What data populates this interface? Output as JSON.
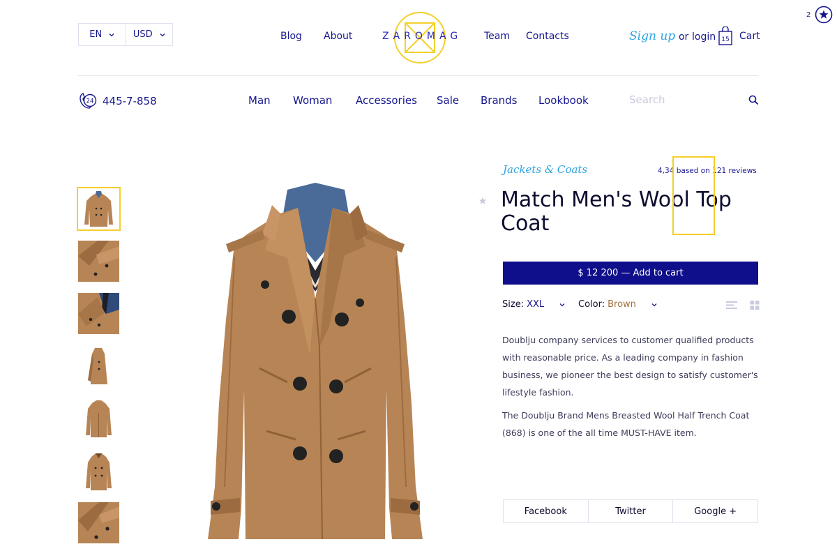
{
  "colors": {
    "primary": "#0f0f8c",
    "accent_blue": "#2ba3e0",
    "logo_yellow": "#f5cf2b",
    "coat_brown": "#b78455",
    "color_value": "#a0703a"
  },
  "header": {
    "language": "EN",
    "currency": "USD",
    "nav_left": [
      "Blog",
      "About"
    ],
    "logo": "ZAROMAG",
    "nav_right": [
      "Team",
      "Contacts"
    ],
    "sign_up": "Sign up",
    "or": "or",
    "login": "login",
    "cart_count": "15",
    "cart_label": "Cart",
    "corner_count": "2"
  },
  "subheader": {
    "phone_badge": "24",
    "phone": "445-7-858",
    "categories": [
      "Man",
      "Woman",
      "Accessories",
      "Sale",
      "Brands",
      "Lookbook"
    ],
    "search_placeholder": "Search"
  },
  "gallery": {
    "thumbnails": [
      "front",
      "lapel-detail",
      "collar-detail",
      "side",
      "back",
      "front-alt",
      "button-detail"
    ],
    "active_index": 0,
    "icons": [
      "coat-image"
    ]
  },
  "product": {
    "category": "Jackets & Coats",
    "rating": "4,34",
    "rating_text": "based on 121 reviews",
    "title": "Match Men's Wool Top Coat",
    "buy_label": "$ 12 200 — Add to cart",
    "size_label": "Size:",
    "size_value": "XXL",
    "color_label": "Color:",
    "color_value": "Brown",
    "description": [
      "Doublju company services to customer qualified products with reasonable price. As a leading company in fashion business, we pioneer the best design to satisfy customer's lifestyle fashion.",
      "The Doublju Brand Mens Breasted Wool Half Trench Coat (868) is one of the all time MUST-HAVE item."
    ],
    "share": [
      "Facebook",
      "Twitter",
      "Google +"
    ]
  }
}
